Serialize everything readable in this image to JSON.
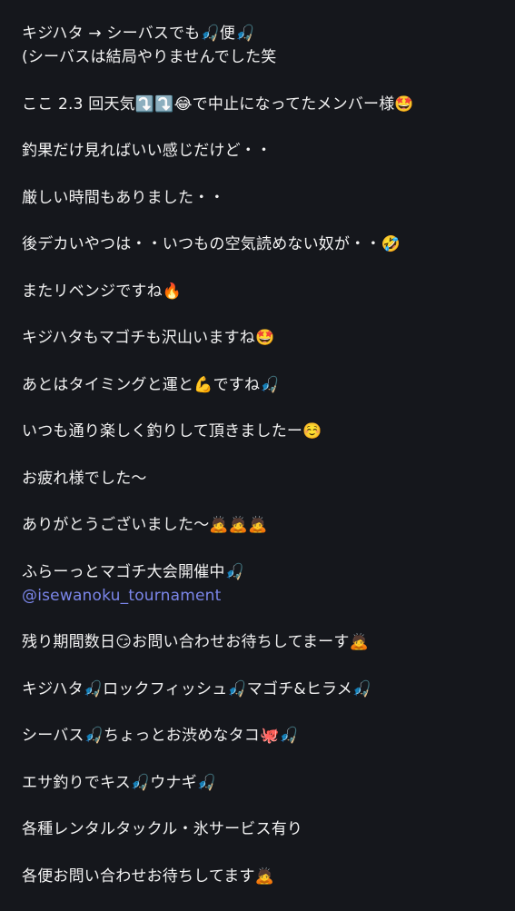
{
  "post": {
    "paragraphs": [
      [
        "キジハタ → シーバスでも🎣便🎣",
        "(シーバスは結局やりませんでした笑"
      ],
      [
        "ここ 2.3 回天気⤵️⤵️😂で中止になってたメンバー様🤩"
      ],
      [
        "釣果だけ見ればいい感じだけど・・"
      ],
      [
        "厳しい時間もありました・・"
      ],
      [
        "後デカいやつは・・いつもの空気読めない奴が・・🤣"
      ],
      [
        "またリベンジですね🔥"
      ],
      [
        "キジハタもマゴチも沢山いますね🤩"
      ],
      [
        "あとはタイミングと運と💪ですね🎣"
      ],
      [
        "いつも通り楽しく釣りして頂きましたー☺️"
      ],
      [
        "お疲れ様でした〜"
      ],
      [
        "ありがとうございました〜🙇🙇🙇"
      ],
      [
        "ふらーっとマゴチ大会開催中🎣"
      ],
      [
        "残り期間数日😏お問い合わせお待ちしてまーす🙇"
      ],
      [
        "キジハタ🎣ロックフィッシュ🎣マゴチ&ヒラメ🎣"
      ],
      [
        "シーバス🎣ちょっとお渋めなタコ🐙🎣"
      ],
      [
        "エサ釣りでキス🎣ウナギ🎣"
      ],
      [
        "各種レンタルタックル・氷サービス有り"
      ],
      [
        "各便お問い合わせお待ちしてます🙇"
      ]
    ],
    "mention": "@isewanoku_tournament"
  },
  "colors": {
    "background": "#15171c",
    "text": "#f2f2f2",
    "mention": "#7b86ea"
  }
}
